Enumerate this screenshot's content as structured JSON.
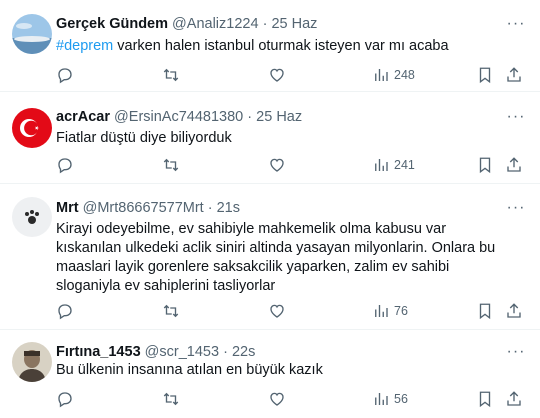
{
  "tweets": [
    {
      "name": "Gerçek Gündem",
      "handle": "@Analiz1224",
      "time": "25 Haz",
      "hashtag": "#deprem",
      "text": " varken halen istanbul oturmak isteyen var mı acaba",
      "views": "248",
      "avatar": "sky-landscape-avatar"
    },
    {
      "name": "acrAcar",
      "handle": "@ErsinAc74481380",
      "time": "25 Haz",
      "text": "Fiatlar düştü diye biliyorduk",
      "views": "241",
      "avatar": "turkish-flag-avatar"
    },
    {
      "name": "Mrt",
      "handle": "@Mrt86667577Mrt",
      "time": "21s",
      "text": "Kirayi odeyebilme, ev sahibiyle mahkemelik olma kabusu var kıskanılan ulkedeki aclik siniri altinda yasayan milyonlarin. Onlara bu maaslari layik gorenlere saksakcilik yaparken, zalim ev sahibi sloganiyla ev sahiplerini tasliyorlar",
      "views": "76",
      "avatar": "paw-avatar"
    },
    {
      "name": "Fırtına_1453",
      "handle": "@scr_1453",
      "time": "22s",
      "text": "Bu ülkenin insanına atılan en büyük kazık",
      "views": "56",
      "avatar": "portrait-avatar"
    }
  ],
  "separator": "·",
  "more_label": "···",
  "colors": {
    "text": "#0f1419",
    "secondary": "#536471",
    "accent": "#1d9bf0",
    "border": "#eff3f4"
  }
}
